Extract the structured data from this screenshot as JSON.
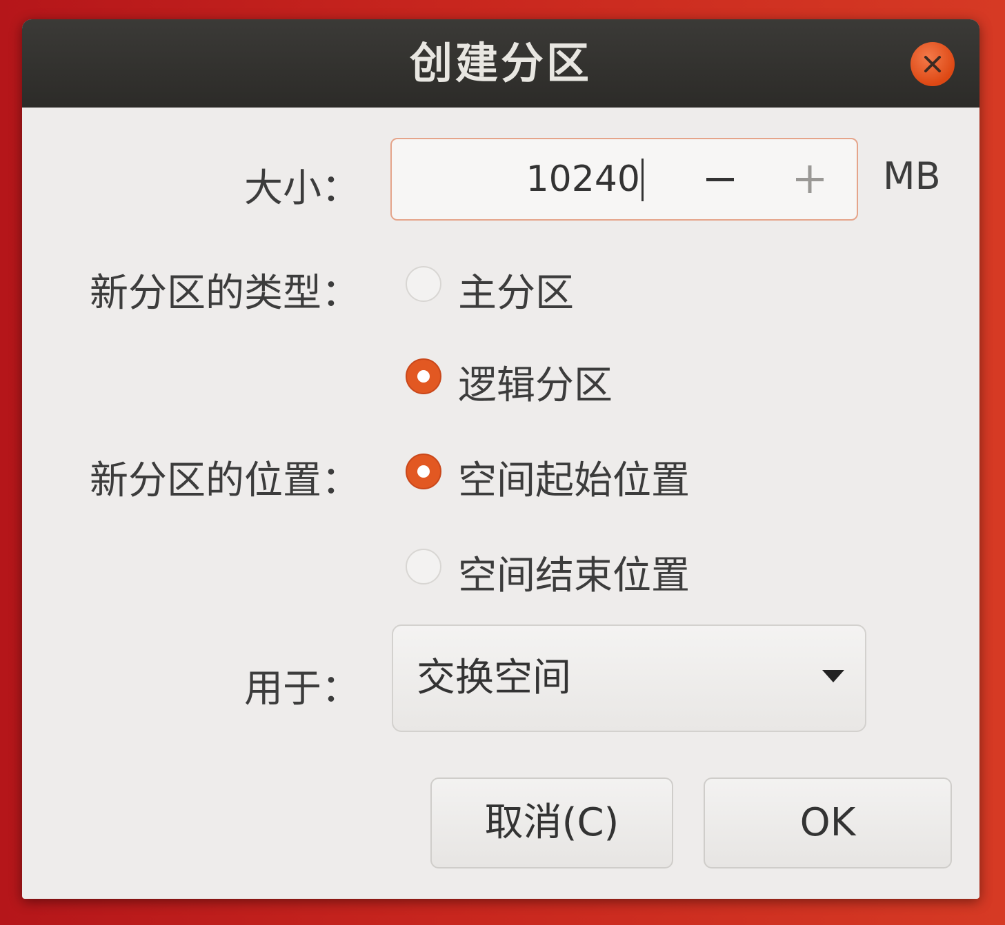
{
  "dialog": {
    "title": "创建分区",
    "close_icon": "close-icon"
  },
  "size": {
    "label": "大小：",
    "value": "10240",
    "decrement_label": "−",
    "increment_label": "+",
    "unit": "MB"
  },
  "partition_type": {
    "label": "新分区的类型：",
    "options": [
      {
        "label": "主分区",
        "selected": false
      },
      {
        "label": "逻辑分区",
        "selected": true
      }
    ]
  },
  "partition_location": {
    "label": "新分区的位置：",
    "options": [
      {
        "label": "空间起始位置",
        "selected": true
      },
      {
        "label": "空间结束位置",
        "selected": false
      }
    ]
  },
  "use_as": {
    "label": "用于：",
    "selected": "交换空间"
  },
  "buttons": {
    "cancel": "取消(C)",
    "ok": "OK"
  },
  "colors": {
    "accent": "#e25822",
    "titlebar": "#2f2e2b",
    "dialog_bg": "#eeeceb"
  }
}
